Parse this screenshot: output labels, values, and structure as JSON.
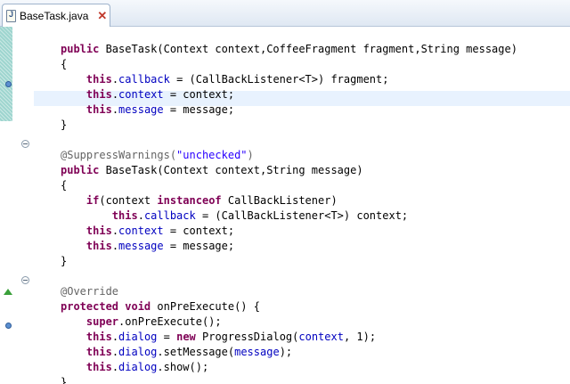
{
  "tab": {
    "title": "BaseTask.java",
    "close_glyph": "✕",
    "icon": "java-file-icon"
  },
  "editor": {
    "lines": [
      [
        {
          "t": "    "
        }
      ],
      [
        {
          "t": "public ",
          "c": "kw"
        },
        {
          "t": "BaseTask(Context context,CoffeeFragment fragment,String message)"
        }
      ],
      [
        {
          "t": "{"
        }
      ],
      [
        {
          "t": "    "
        },
        {
          "t": "this",
          "c": "kw"
        },
        {
          "t": "."
        },
        {
          "t": "callback",
          "c": "fld"
        },
        {
          "t": " = (CallBackListener<T>) fragment;"
        }
      ],
      [
        {
          "t": "    "
        },
        {
          "t": "this",
          "c": "kw"
        },
        {
          "t": "."
        },
        {
          "t": "context",
          "c": "fld"
        },
        {
          "t": " = context;"
        }
      ],
      [
        {
          "t": "    "
        },
        {
          "t": "this",
          "c": "kw"
        },
        {
          "t": "."
        },
        {
          "t": "message",
          "c": "fld"
        },
        {
          "t": " = message;"
        }
      ],
      [
        {
          "t": "}"
        }
      ],
      [
        {
          "t": ""
        }
      ],
      [
        {
          "t": "@SuppressWarnings(",
          "c": "ann"
        },
        {
          "t": "\"unchecked\"",
          "c": "str"
        },
        {
          "t": ")",
          "c": "ann"
        }
      ],
      [
        {
          "t": "public ",
          "c": "kw"
        },
        {
          "t": "BaseTask(Context context,String message)"
        }
      ],
      [
        {
          "t": "{"
        }
      ],
      [
        {
          "t": "    "
        },
        {
          "t": "if",
          "c": "kw"
        },
        {
          "t": "(context "
        },
        {
          "t": "instanceof",
          "c": "kw"
        },
        {
          "t": " CallBackListener)"
        }
      ],
      [
        {
          "t": "        "
        },
        {
          "t": "this",
          "c": "kw"
        },
        {
          "t": "."
        },
        {
          "t": "callback",
          "c": "fld"
        },
        {
          "t": " = (CallBackListener<T>) context;"
        }
      ],
      [
        {
          "t": "    "
        },
        {
          "t": "this",
          "c": "kw"
        },
        {
          "t": "."
        },
        {
          "t": "context",
          "c": "fld"
        },
        {
          "t": " = context;"
        }
      ],
      [
        {
          "t": "    "
        },
        {
          "t": "this",
          "c": "kw"
        },
        {
          "t": "."
        },
        {
          "t": "message",
          "c": "fld"
        },
        {
          "t": " = message;"
        }
      ],
      [
        {
          "t": "}"
        }
      ],
      [
        {
          "t": ""
        }
      ],
      [
        {
          "t": "@Override",
          "c": "ann"
        }
      ],
      [
        {
          "t": "protected ",
          "c": "kw"
        },
        {
          "t": "void ",
          "c": "kw"
        },
        {
          "t": "onPreExecute() {"
        }
      ],
      [
        {
          "t": "    "
        },
        {
          "t": "super",
          "c": "kw"
        },
        {
          "t": ".onPreExecute();"
        }
      ],
      [
        {
          "t": "    "
        },
        {
          "t": "this",
          "c": "kw"
        },
        {
          "t": "."
        },
        {
          "t": "dialog",
          "c": "fld"
        },
        {
          "t": " = "
        },
        {
          "t": "new ",
          "c": "kw"
        },
        {
          "t": "ProgressDialog("
        },
        {
          "t": "context",
          "c": "fld"
        },
        {
          "t": ", 1);"
        }
      ],
      [
        {
          "t": "    "
        },
        {
          "t": "this",
          "c": "kw"
        },
        {
          "t": "."
        },
        {
          "t": "dialog",
          "c": "fld"
        },
        {
          "t": ".setMessage("
        },
        {
          "t": "message",
          "c": "fld"
        },
        {
          "t": ");"
        }
      ],
      [
        {
          "t": "    "
        },
        {
          "t": "this",
          "c": "kw"
        },
        {
          "t": "."
        },
        {
          "t": "dialog",
          "c": "fld"
        },
        {
          "t": ".show();"
        }
      ],
      [
        {
          "t": "}"
        }
      ]
    ]
  },
  "gutter": {
    "fold_markers": [
      "fold-toggle-icon",
      "fold-toggle-icon",
      "fold-toggle-icon"
    ],
    "markers": [
      "occurrence-marker-icon",
      "override-marker-icon",
      "occurrence-marker-icon"
    ]
  }
}
